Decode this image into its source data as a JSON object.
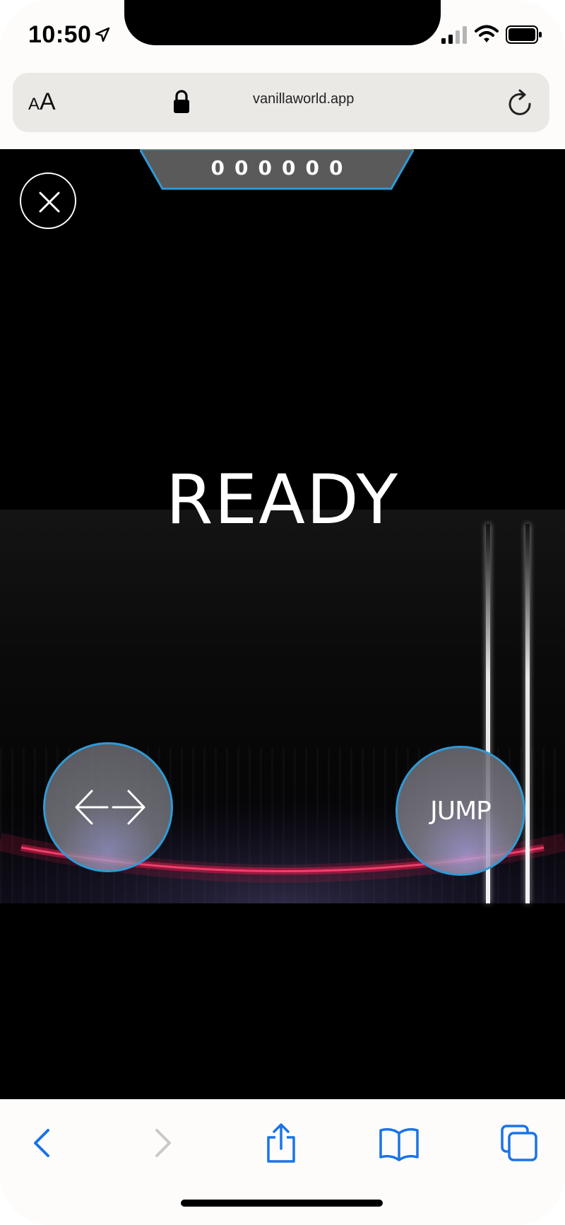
{
  "status_bar": {
    "time": "10:50",
    "icons": [
      "location-arrow-icon",
      "signal-icon",
      "wifi-icon",
      "battery-icon"
    ]
  },
  "browser": {
    "text_size_button": {
      "small": "A",
      "big": "A"
    },
    "url": "vanillaworld.app",
    "icons": [
      "lock-icon",
      "reload-icon"
    ]
  },
  "game": {
    "score": "000000",
    "status_message": "READY",
    "jump_label": "JUMP",
    "icons": [
      "close-icon",
      "left-right-arrows-icon"
    ],
    "colors": {
      "button_border": "#2f9ad6",
      "ring_glow": "#d81b4a"
    }
  },
  "toolbar": {
    "icons": [
      "back-icon",
      "forward-icon",
      "share-icon",
      "bookmarks-icon",
      "tabs-icon"
    ],
    "accent": "#1a73e8"
  }
}
